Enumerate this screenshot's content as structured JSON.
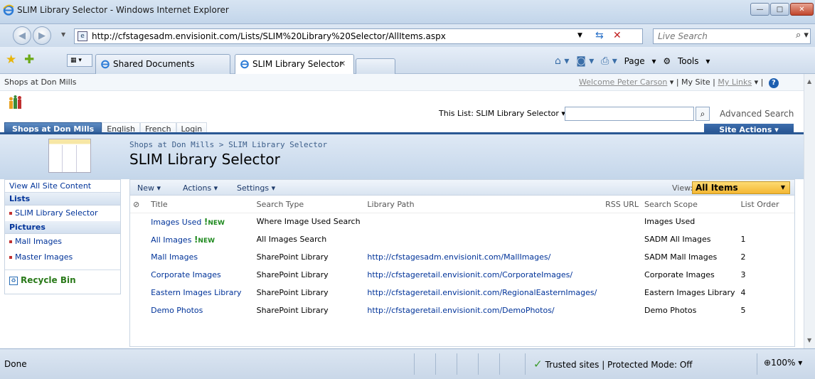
{
  "window": {
    "title": "SLIM Library Selector - Windows Internet Explorer",
    "min_glyph": "—",
    "max_glyph": "□",
    "close_glyph": "✕"
  },
  "address": {
    "url": "http://cfstagesadm.envisionit.com/Lists/SLIM%20Library%20Selector/AllItems.aspx",
    "search_placeholder": "Live Search"
  },
  "tabs": [
    {
      "label": "Shared Documents"
    },
    {
      "label": "SLIM Library Selector"
    }
  ],
  "command_bar": {
    "page": "Page",
    "tools": "Tools"
  },
  "global": {
    "site_name": "Shops at Don Mills",
    "welcome": "Welcome Peter Carson",
    "my_site": "My Site",
    "my_links": "My Links"
  },
  "header": {
    "search_scope": "This List: SLIM Library Selector",
    "advanced_search": "Advanced Search",
    "site_actions": "Site Actions"
  },
  "topnav": [
    {
      "label": "Shops at Don Mills"
    },
    {
      "label": "English"
    },
    {
      "label": "French"
    },
    {
      "label": "Login"
    }
  ],
  "page": {
    "breadcrumb_site": "Shops at Don Mills",
    "breadcrumb_sep": ">",
    "breadcrumb_list": "SLIM Library Selector",
    "title": "SLIM Library Selector"
  },
  "leftnav": {
    "view_all": "View All Site Content",
    "lists_heading": "Lists",
    "lists": [
      "SLIM Library Selector"
    ],
    "pictures_heading": "Pictures",
    "pictures": [
      "Mall Images",
      "Master Images"
    ],
    "recycle_bin": "Recycle Bin"
  },
  "toolbar": {
    "new": "New",
    "actions": "Actions",
    "settings": "Settings",
    "view_label": "View:",
    "view_value": "All Items"
  },
  "list": {
    "columns": [
      "Title",
      "Search Type",
      "Library Path",
      "RSS URL",
      "Search Scope",
      "List Order"
    ],
    "new_tag": "NEW",
    "rows": [
      {
        "title": "Images Used",
        "is_new": true,
        "type": "Where Image Used Search",
        "path": "",
        "rss": "",
        "scope": "Images Used",
        "order": ""
      },
      {
        "title": "All Images",
        "is_new": true,
        "type": "All Images Search",
        "path": "",
        "rss": "",
        "scope": "SADM All Images",
        "order": "1"
      },
      {
        "title": "Mall Images",
        "is_new": false,
        "type": "SharePoint Library",
        "path": "http://cfstagesadm.envisionit.com/MallImages/",
        "rss": "",
        "scope": "SADM Mall Images",
        "order": "2"
      },
      {
        "title": "Corporate Images",
        "is_new": false,
        "type": "SharePoint Library",
        "path": "http://cfstageretail.envisionit.com/CorporateImages/",
        "rss": "",
        "scope": "Corporate Images",
        "order": "3"
      },
      {
        "title": "Eastern Images Library",
        "is_new": false,
        "type": "SharePoint Library",
        "path": "http://cfstageretail.envisionit.com/RegionalEasternImages/",
        "rss": "",
        "scope": "Eastern Images Library",
        "order": "4"
      },
      {
        "title": "Demo Photos",
        "is_new": false,
        "type": "SharePoint Library",
        "path": "http://cfstageretail.envisionit.com/DemoPhotos/",
        "rss": "",
        "scope": "Demo Photos",
        "order": "5"
      }
    ]
  },
  "status": {
    "done": "Done",
    "zone": "Trusted sites | Protected Mode: Off",
    "zoom": "100%"
  },
  "colors": {
    "link": "#003399",
    "new_tag": "#1f8a1f",
    "site_actions_bg": "#1f4a86",
    "view_select_bg": "#f4b733"
  }
}
